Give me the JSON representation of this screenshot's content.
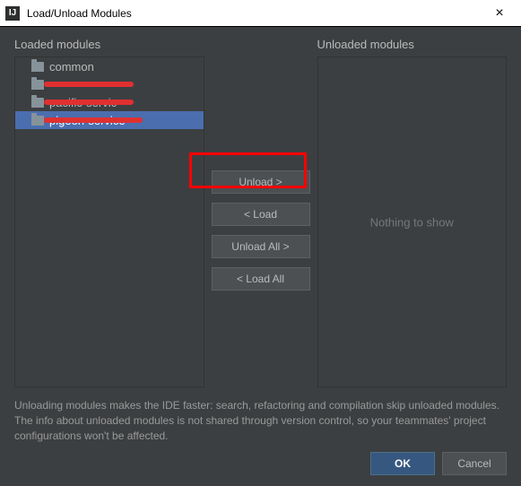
{
  "window": {
    "title": "Load/Unload Modules",
    "app_icon_text": "IJ"
  },
  "panels": {
    "loaded_label": "Loaded modules",
    "unloaded_label": "Unloaded modules",
    "empty_text": "Nothing to show"
  },
  "loaded_modules": [
    {
      "label": "common",
      "redacted": false,
      "selected": false
    },
    {
      "label": "",
      "redacted": true,
      "selected": false
    },
    {
      "label": "pacific-servic",
      "redacted": true,
      "selected": false
    },
    {
      "label": "pigeon-service",
      "redacted": true,
      "selected": true
    }
  ],
  "buttons": {
    "unload": "Unload >",
    "load": "< Load",
    "unload_all": "Unload All >",
    "load_all": "< Load All",
    "ok": "OK",
    "cancel": "Cancel"
  },
  "hint": "Unloading modules makes the IDE faster: search, refactoring and compilation skip unloaded modules. The info about unloaded modules is not shared through version control, so your teammates' project configurations won't be affected."
}
